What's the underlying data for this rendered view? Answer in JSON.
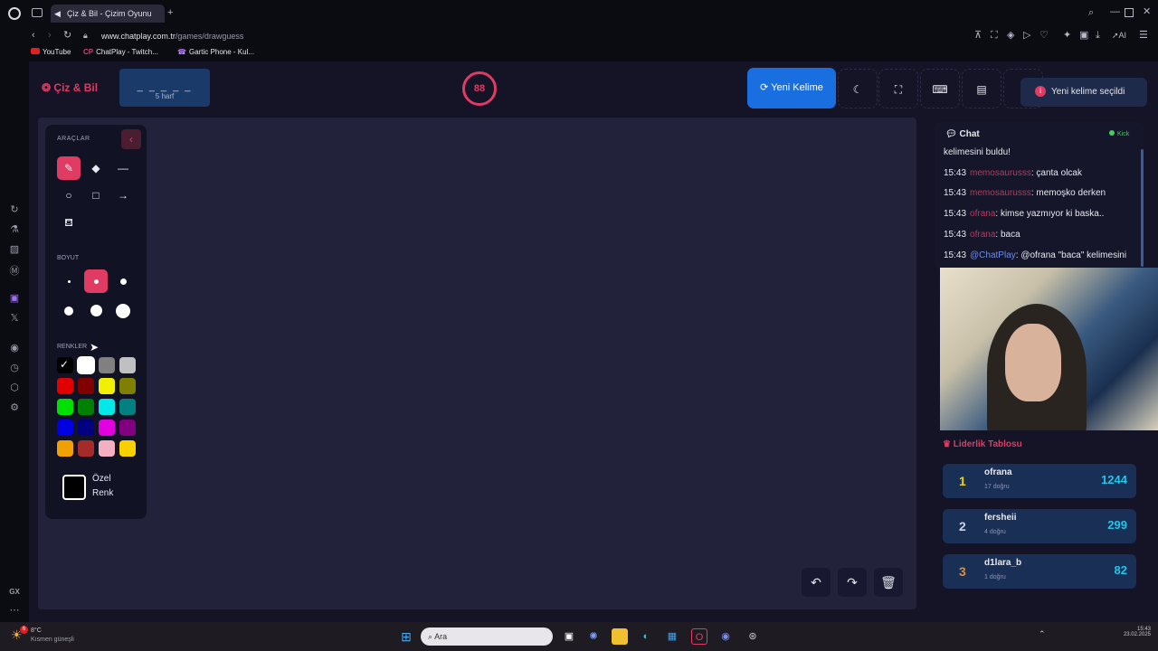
{
  "browser": {
    "tab_title": "Çiz & Bil - Çizim Oyunu",
    "url_host": "www.chatplay.com.tr",
    "url_path": "/games/drawguess",
    "bookmarks": [
      "YouTube",
      "ChatPlay - Twitch...",
      "Gartic Phone - Kul..."
    ],
    "ai_label": "AI",
    "gx_label": "GX"
  },
  "header": {
    "logo": "Çiz & Bil",
    "word_mask": "_ _ _ _ _",
    "word_hint": "5 harf",
    "timer": "88",
    "new_word_button": "Yeni Kelime",
    "toast": "Yeni kelime seçildi"
  },
  "tools_panel": {
    "tools_heading": "ARAÇLAR",
    "size_heading": "BOYUT",
    "colors_heading": "RENKLER",
    "custom_color_line1": "Özel",
    "custom_color_line2": "Renk",
    "colors": [
      "#000000",
      "#ffffff",
      "#808080",
      "#c0c0c0",
      "#e00000",
      "#800000",
      "#f0f000",
      "#808000",
      "#00e000",
      "#008000",
      "#00e8e8",
      "#008080",
      "#0000e0",
      "#000080",
      "#e000e0",
      "#800080",
      "#f0a000",
      "#a52a2a",
      "#f4b0c0",
      "#f8d000"
    ]
  },
  "chat": {
    "title": "Chat",
    "status": "Kick",
    "lines": [
      {
        "time": "",
        "user": "",
        "text": "kelimesini buldu!"
      },
      {
        "time": "15:43",
        "user": "memosaurusss",
        "text": ": çanta olcak"
      },
      {
        "time": "15:43",
        "user": "memosaurusss",
        "text": ": memoşko derken"
      },
      {
        "time": "15:43",
        "user": "ofrana",
        "text": ": kimse yazmıyor ki baska.."
      },
      {
        "time": "15:43",
        "user": "ofrana",
        "text": ": baca"
      },
      {
        "time": "15:43",
        "user": "@ChatPlay",
        "text": ": @ofrana \"baca\" kelimesini"
      }
    ]
  },
  "leaderboard": {
    "title": "Liderlik Tablosu",
    "entries": [
      {
        "rank": "1",
        "name": "ofrana",
        "sub": "17 doğru",
        "score": "1244"
      },
      {
        "rank": "2",
        "name": "fersheii",
        "sub": "4 doğru",
        "score": "299"
      },
      {
        "rank": "3",
        "name": "d1lara_b",
        "sub": "1 doğru",
        "score": "82"
      }
    ]
  },
  "taskbar": {
    "weather": "8°C",
    "weather_sub": "Kısmen güneşli",
    "search": "Ara",
    "time": "15:43",
    "date": "23.02.2025",
    "badge": "6"
  },
  "colors": {
    "accent": "#e03b62",
    "button_blue": "#1a6fe0",
    "canvas": "#22223a",
    "leaderboard_item": "#1a2f55"
  }
}
